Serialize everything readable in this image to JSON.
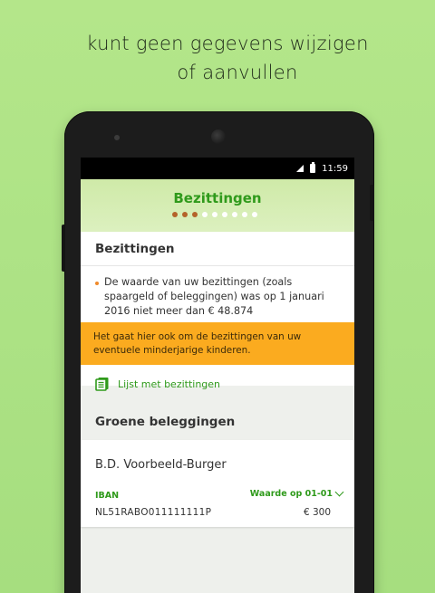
{
  "headline": {
    "line1": "kunt geen gegevens wijzigen",
    "line2": "of aanvullen"
  },
  "status_bar": {
    "time": "11:59"
  },
  "app_bar": {
    "title": "Bezittingen",
    "page_dots": {
      "total": 9,
      "active": 3
    }
  },
  "bezittingen_card": {
    "heading": "Bezittingen",
    "bullet": "De waarde van uw bezittingen (zoals spaargeld of beleggingen) was op 1 januari 2016 niet meer dan € 48.874",
    "warning": "Het gaat hier ook om de bezittingen van uw eventuele minderjarige kinderen.",
    "list_link": "Lijst met bezittingen"
  },
  "groene_beleggingen": {
    "heading": "Groene beleggingen",
    "owner": "B.D. Voorbeeld-Burger",
    "iban_label": "IBAN",
    "value_label": "Waarde op 01-01",
    "iban": "NL51RABO011111111P",
    "amount": "€ 300"
  },
  "colors": {
    "background": "#b0e487",
    "accent_green": "#2f9a1b",
    "warning_orange": "#fbab1f",
    "dot_active": "#b4632a"
  }
}
